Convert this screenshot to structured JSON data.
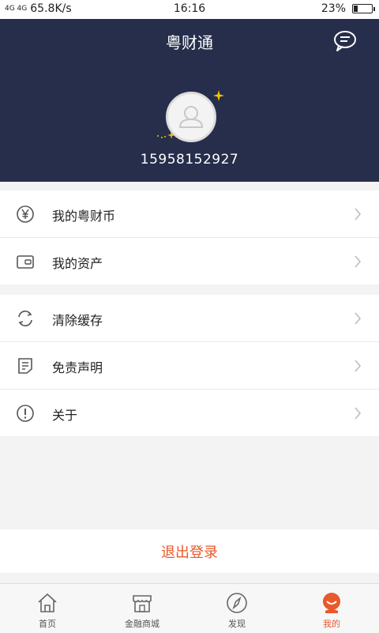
{
  "status_bar": {
    "signal": "4G 4G",
    "net_speed": "65.8K/s",
    "time": "16:16",
    "battery": "23%"
  },
  "header": {
    "title": "粤财通",
    "phone": "15958152927"
  },
  "menu_groups": [
    {
      "items": [
        {
          "label": "我的粤财币",
          "icon": "yen-coin-icon"
        },
        {
          "label": "我的资产",
          "icon": "wallet-icon"
        }
      ]
    },
    {
      "items": [
        {
          "label": "清除缓存",
          "icon": "refresh-icon"
        },
        {
          "label": "免责声明",
          "icon": "document-icon"
        },
        {
          "label": "关于",
          "icon": "info-icon"
        }
      ]
    }
  ],
  "logout_label": "退出登录",
  "tabs": [
    {
      "label": "首页",
      "icon": "home-icon"
    },
    {
      "label": "金融商城",
      "icon": "store-icon"
    },
    {
      "label": "发现",
      "icon": "compass-icon"
    },
    {
      "label": "我的",
      "icon": "user-icon",
      "active": true
    }
  ],
  "colors": {
    "header_bg": "#262e4b",
    "accent": "#e8592b",
    "sparkle": "#f5c400"
  }
}
